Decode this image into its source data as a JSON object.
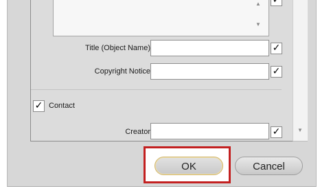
{
  "fields": {
    "title_label": "Title (Object Name)",
    "title_value": "",
    "title_checked": "✓",
    "copyright_label": "Copyright Notice",
    "copyright_value": "",
    "copyright_checked": "✓",
    "creator_label": "Creator",
    "creator_value": "",
    "creator_checked": "✓",
    "textarea_checked": "✓"
  },
  "contact": {
    "label": "Contact",
    "checked": "✓"
  },
  "buttons": {
    "ok_label": "OK",
    "cancel_label": "Cancel"
  },
  "icons": {
    "scroll_up": "▲",
    "scroll_down": "▼"
  }
}
